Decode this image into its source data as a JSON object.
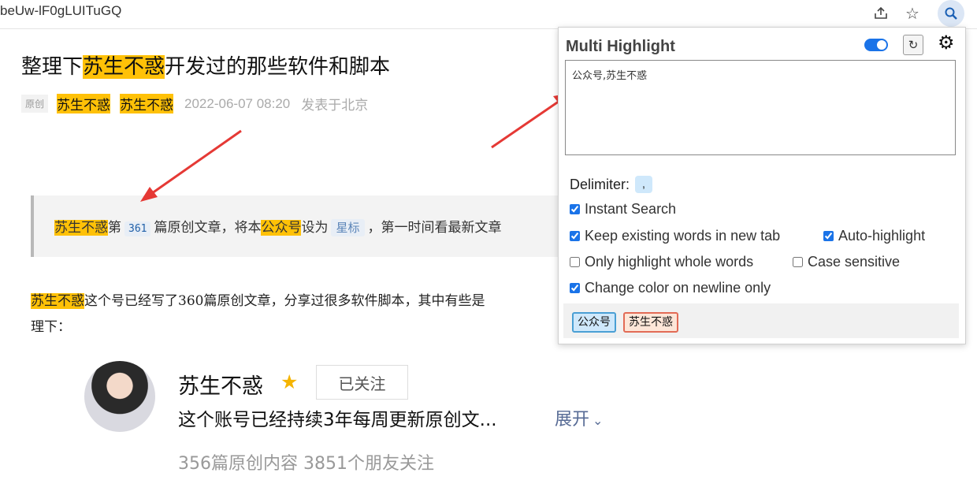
{
  "browser": {
    "url_fragment": "beUw-lF0gLUITuGQ",
    "icons": [
      "share-icon",
      "bookmark-star-icon",
      "extension-search-icon"
    ]
  },
  "article": {
    "title_prefix": "整理下",
    "title_highlight": "苏生不惑",
    "title_suffix": "开发过的那些软件和脚本",
    "original_tag": "原创",
    "author_1": "苏生不惑",
    "author_2": "苏生不惑",
    "date": "2022-06-07 08:20",
    "location": "发表于北京",
    "quote": {
      "hl_name": "苏生不惑",
      "part1": "第",
      "count": "361",
      "part2": "篇原创文章，将本",
      "hl_account": "公众号",
      "part3": "设为",
      "star_tag": "星标",
      "part4": "，第一时间看最新文章"
    },
    "paragraph": {
      "hl_name": "苏生不惑",
      "line1": "这个号已经写了360篇原创文章，分享过很多软件脚本，其中有些是",
      "line2": "理下："
    }
  },
  "profile": {
    "name": "苏生不惑",
    "follow_label": "已关注",
    "description": "这个账号已经持续3年每周更新原创文...",
    "expand_label": "展开",
    "stats": "356篇原创内容   3851个朋友关注"
  },
  "popup": {
    "title": "Multi Highlight",
    "toggle_on": true,
    "refresh_symbol": "↻",
    "words_value": "公众号,苏生不惑",
    "delimiter_label": "Delimiter:",
    "delimiter_value": ",",
    "options": {
      "instant_search": "Instant Search",
      "keep_words": "Keep existing words in new tab",
      "auto_highlight": "Auto-highlight",
      "whole_words": "Only highlight whole words",
      "case_sensitive": "Case sensitive",
      "newline_color": "Change color on newline only"
    },
    "chips": [
      "公众号",
      "苏生不惑"
    ],
    "colors": {
      "chip1_border": "#4a9fd4",
      "chip2_border": "#e26b56",
      "highlight": "#ffc107",
      "toggle": "#1a73e8"
    }
  }
}
